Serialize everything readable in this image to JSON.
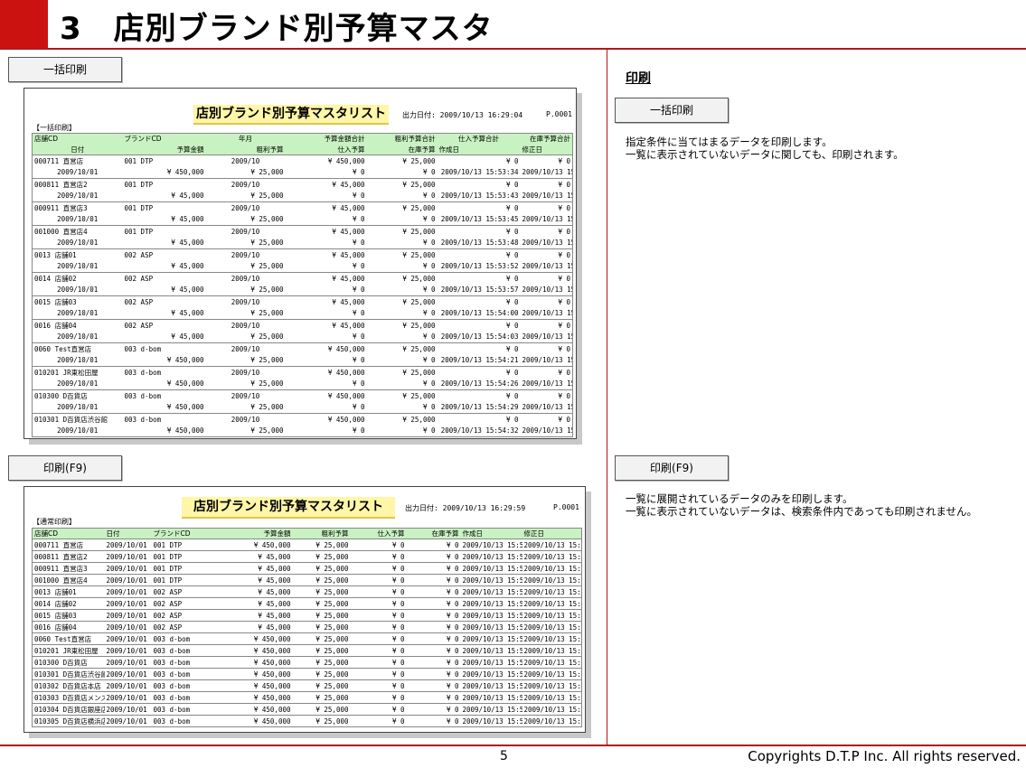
{
  "header": {
    "title": "3　店別ブランド別予算マスタ"
  },
  "buttons": {
    "bulk_print": "一括印刷",
    "print_f9": "印刷(F9)"
  },
  "right_panel": {
    "heading": "印刷",
    "bulk_button": "一括印刷",
    "bulk_desc": [
      "指定条件に当てはまるデータを印刷します。",
      "一覧に表示されていないデータに関しても、印刷されます。"
    ],
    "f9_button": "印刷(F9)",
    "f9_desc": [
      "一覧に展開されているデータのみを印刷します。",
      "一覧に表示されていないデータは、検索条件内であっても印刷されません。"
    ]
  },
  "footer": {
    "page": "5",
    "copyright": "Copyrights  D.T.P Inc. All rights reserved."
  },
  "report1": {
    "title": "店別ブランド別予算マスタリスト",
    "output_date": "出力日付: 2009/10/13 16:29:04",
    "page": "P.0001",
    "label": "【一括印刷】",
    "headers_row1": [
      "店舗CD",
      "ブランドCD",
      "年月",
      "予算金額合計",
      "粗利予算合計",
      "仕入予算合計",
      "在庫予算合計"
    ],
    "headers_row2": [
      "日付",
      "予算金額",
      "粗利予算",
      "仕入予算",
      "在庫予算",
      "作成日",
      "修正日"
    ],
    "records": [
      {
        "store": "000711 直営店",
        "brand": "001 DTP",
        "ym": "2009/10",
        "budget_total": "¥ 450,000",
        "gross_total": "¥ 25,000",
        "purchase_total": "¥ 0",
        "stock_total": "¥ 0",
        "date": "2009/10/01",
        "budget": "¥ 450,000",
        "gross": "¥ 25,000",
        "purchase": "¥ 0",
        "stock": "¥ 0",
        "created": "2009/10/13 15:53:34",
        "modified": "2009/10/13 15:53:34"
      },
      {
        "store": "000811 直営店2",
        "brand": "001 DTP",
        "ym": "2009/10",
        "budget_total": "¥ 45,000",
        "gross_total": "¥ 25,000",
        "purchase_total": "¥ 0",
        "stock_total": "¥ 0",
        "date": "2009/10/01",
        "budget": "¥ 45,000",
        "gross": "¥ 25,000",
        "purchase": "¥ 0",
        "stock": "¥ 0",
        "created": "2009/10/13 15:53:43",
        "modified": "2009/10/13 15:53:43"
      },
      {
        "store": "000911 直営店3",
        "brand": "001 DTP",
        "ym": "2009/10",
        "budget_total": "¥ 45,000",
        "gross_total": "¥ 25,000",
        "purchase_total": "¥ 0",
        "stock_total": "¥ 0",
        "date": "2009/10/01",
        "budget": "¥ 45,000",
        "gross": "¥ 25,000",
        "purchase": "¥ 0",
        "stock": "¥ 0",
        "created": "2009/10/13 15:53:45",
        "modified": "2009/10/13 15:53:45"
      },
      {
        "store": "001000 直営店4",
        "brand": "001 DTP",
        "ym": "2009/10",
        "budget_total": "¥ 45,000",
        "gross_total": "¥ 25,000",
        "purchase_total": "¥ 0",
        "stock_total": "¥ 0",
        "date": "2009/10/01",
        "budget": "¥ 45,000",
        "gross": "¥ 25,000",
        "purchase": "¥ 0",
        "stock": "¥ 0",
        "created": "2009/10/13 15:53:48",
        "modified": "2009/10/13 15:53:48"
      },
      {
        "store": "0013 店舗01",
        "brand": "002 ASP",
        "ym": "2009/10",
        "budget_total": "¥ 45,000",
        "gross_total": "¥ 25,000",
        "purchase_total": "¥ 0",
        "stock_total": "¥ 0",
        "date": "2009/10/01",
        "budget": "¥ 45,000",
        "gross": "¥ 25,000",
        "purchase": "¥ 0",
        "stock": "¥ 0",
        "created": "2009/10/13 15:53:52",
        "modified": "2009/10/13 15:54:08"
      },
      {
        "store": "0014 店舗02",
        "brand": "002 ASP",
        "ym": "2009/10",
        "budget_total": "¥ 45,000",
        "gross_total": "¥ 25,000",
        "purchase_total": "¥ 0",
        "stock_total": "¥ 0",
        "date": "2009/10/01",
        "budget": "¥ 45,000",
        "gross": "¥ 25,000",
        "purchase": "¥ 0",
        "stock": "¥ 0",
        "created": "2009/10/13 15:53:57",
        "modified": "2009/10/13 15:53:57"
      },
      {
        "store": "0015 店舗03",
        "brand": "002 ASP",
        "ym": "2009/10",
        "budget_total": "¥ 45,000",
        "gross_total": "¥ 25,000",
        "purchase_total": "¥ 0",
        "stock_total": "¥ 0",
        "date": "2009/10/01",
        "budget": "¥ 45,000",
        "gross": "¥ 25,000",
        "purchase": "¥ 0",
        "stock": "¥ 0",
        "created": "2009/10/13 15:54:00",
        "modified": "2009/10/13 15:54:00"
      },
      {
        "store": "0016 店舗04",
        "brand": "002 ASP",
        "ym": "2009/10",
        "budget_total": "¥ 45,000",
        "gross_total": "¥ 25,000",
        "purchase_total": "¥ 0",
        "stock_total": "¥ 0",
        "date": "2009/10/01",
        "budget": "¥ 45,000",
        "gross": "¥ 25,000",
        "purchase": "¥ 0",
        "stock": "¥ 0",
        "created": "2009/10/13 15:54:03",
        "modified": "2009/10/13 15:54:03"
      },
      {
        "store": "0060 Test直営店",
        "brand": "003 d-bom",
        "ym": "2009/10",
        "budget_total": "¥ 450,000",
        "gross_total": "¥ 25,000",
        "purchase_total": "¥ 0",
        "stock_total": "¥ 0",
        "date": "2009/10/01",
        "budget": "¥ 450,000",
        "gross": "¥ 25,000",
        "purchase": "¥ 0",
        "stock": "¥ 0",
        "created": "2009/10/13 15:54:21",
        "modified": "2009/10/13 15:54:21"
      },
      {
        "store": "010201 JR東松田屋",
        "brand": "003 d-bom",
        "ym": "2009/10",
        "budget_total": "¥ 450,000",
        "gross_total": "¥ 25,000",
        "purchase_total": "¥ 0",
        "stock_total": "¥ 0",
        "date": "2009/10/01",
        "budget": "¥ 450,000",
        "gross": "¥ 25,000",
        "purchase": "¥ 0",
        "stock": "¥ 0",
        "created": "2009/10/13 15:54:26",
        "modified": "2009/10/13 15:54:26"
      },
      {
        "store": "010300 D百貨店",
        "brand": "003 d-bom",
        "ym": "2009/10",
        "budget_total": "¥ 450,000",
        "gross_total": "¥ 25,000",
        "purchase_total": "¥ 0",
        "stock_total": "¥ 0",
        "date": "2009/10/01",
        "budget": "¥ 450,000",
        "gross": "¥ 25,000",
        "purchase": "¥ 0",
        "stock": "¥ 0",
        "created": "2009/10/13 15:54:29",
        "modified": "2009/10/13 15:54:29"
      },
      {
        "store": "010301 D百貨店渋谷館",
        "brand": "003 d-bom",
        "ym": "2009/10",
        "budget_total": "¥ 450,000",
        "gross_total": "¥ 25,000",
        "purchase_total": "¥ 0",
        "stock_total": "¥ 0",
        "date": "2009/10/01",
        "budget": "¥ 450,000",
        "gross": "¥ 25,000",
        "purchase": "¥ 0",
        "stock": "¥ 0",
        "created": "2009/10/13 15:54:32",
        "modified": "2009/10/13 15:54:32"
      }
    ]
  },
  "report2": {
    "title": "店別ブランド別予算マスタリスト",
    "output_date": "出力日付: 2009/10/13 16:29:59",
    "page": "P.0001",
    "label": "【通常印刷】",
    "headers": [
      "店舗CD",
      "日付",
      "ブランドCD",
      "予算金額",
      "粗利予算",
      "仕入予算",
      "在庫予算",
      "作成日",
      "修正日"
    ],
    "rows": [
      [
        "000711 直営店",
        "2009/10/01",
        "001 DTP",
        "¥ 450,000",
        "¥ 25,000",
        "¥ 0",
        "¥ 0",
        "2009/10/13 15:53:34",
        "2009/10/13 15:53:34"
      ],
      [
        "000811 直営店2",
        "2009/10/01",
        "001 DTP",
        "¥ 45,000",
        "¥ 25,000",
        "¥ 0",
        "¥ 0",
        "2009/10/13 15:53:43",
        "2009/10/13 15:53:43"
      ],
      [
        "000911 直営店3",
        "2009/10/01",
        "001 DTP",
        "¥ 45,000",
        "¥ 25,000",
        "¥ 0",
        "¥ 0",
        "2009/10/13 15:53:45",
        "2009/10/13 15:53:45"
      ],
      [
        "001000 直営店4",
        "2009/10/01",
        "001 DTP",
        "¥ 45,000",
        "¥ 25,000",
        "¥ 0",
        "¥ 0",
        "2009/10/13 15:53:48",
        "2009/10/13 15:53:48"
      ],
      [
        "0013 店舗01",
        "2009/10/01",
        "002 ASP",
        "¥ 45,000",
        "¥ 25,000",
        "¥ 0",
        "¥ 0",
        "2009/10/13 15:53:52",
        "2009/10/13 15:54:08"
      ],
      [
        "0014 店舗02",
        "2009/10/01",
        "002 ASP",
        "¥ 45,000",
        "¥ 25,000",
        "¥ 0",
        "¥ 0",
        "2009/10/13 15:53:57",
        "2009/10/13 15:53:57"
      ],
      [
        "0015 店舗03",
        "2009/10/01",
        "002 ASP",
        "¥ 45,000",
        "¥ 25,000",
        "¥ 0",
        "¥ 0",
        "2009/10/13 15:54:00",
        "2009/10/13 15:54:00"
      ],
      [
        "0016 店舗04",
        "2009/10/01",
        "002 ASP",
        "¥ 45,000",
        "¥ 25,000",
        "¥ 0",
        "¥ 0",
        "2009/10/13 15:54:03",
        "2009/10/13 15:54:03"
      ],
      [
        "0060 Test直営店",
        "2009/10/01",
        "003 d-bom",
        "¥ 450,000",
        "¥ 25,000",
        "¥ 0",
        "¥ 0",
        "2009/10/13 15:54:21",
        "2009/10/13 15:54:21"
      ],
      [
        "010201 JR東松田屋",
        "2009/10/01",
        "003 d-bom",
        "¥ 450,000",
        "¥ 25,000",
        "¥ 0",
        "¥ 0",
        "2009/10/13 15:54:26",
        "2009/10/13 15:54:26"
      ],
      [
        "010300 D百貨店",
        "2009/10/01",
        "003 d-bom",
        "¥ 450,000",
        "¥ 25,000",
        "¥ 0",
        "¥ 0",
        "2009/10/13 15:54:29",
        "2009/10/13 15:54:29"
      ],
      [
        "010301 D百貨店渋谷館",
        "2009/10/01",
        "003 d-bom",
        "¥ 450,000",
        "¥ 25,000",
        "¥ 0",
        "¥ 0",
        "2009/10/13 15:54:32",
        "2009/10/13 15:54:32"
      ],
      [
        "010302 D百貨店本店",
        "2009/10/01",
        "003 d-bom",
        "¥ 450,000",
        "¥ 25,000",
        "¥ 0",
        "¥ 0",
        "2009/10/13 15:54:39",
        "2009/10/13 15:54:39"
      ],
      [
        "010303 D百貨店メンズ",
        "2009/10/01",
        "003 d-bom",
        "¥ 450,000",
        "¥ 25,000",
        "¥ 0",
        "¥ 0",
        "2009/10/13 15:54:41",
        "2009/10/13 15:54:41"
      ],
      [
        "010304 D百貨店銀座店",
        "2009/10/01",
        "003 d-bom",
        "¥ 450,000",
        "¥ 25,000",
        "¥ 0",
        "¥ 0",
        "2009/10/13 15:54:44",
        "2009/10/13 15:54:44"
      ],
      [
        "010305 D百貨店横浜店",
        "2009/10/01",
        "003 d-bom",
        "¥ 450,000",
        "¥ 25,000",
        "¥ 0",
        "¥ 0",
        "2009/10/13 15:54:46",
        "2009/10/13 15:54:46"
      ]
    ]
  }
}
